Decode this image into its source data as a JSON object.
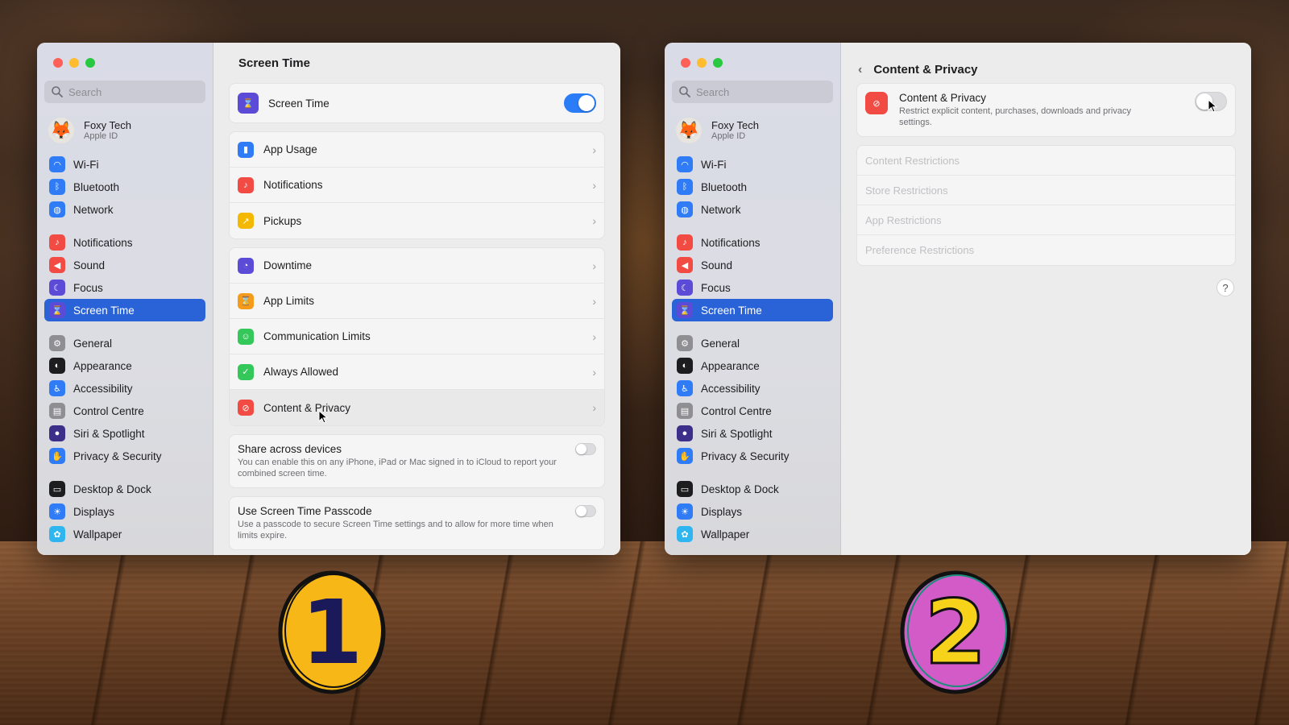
{
  "left_window": {
    "title": "Screen Time",
    "search_placeholder": "Search",
    "profile": {
      "name": "Foxy Tech",
      "sub": "Apple ID"
    },
    "sidebar": [
      {
        "label": "Wi-Fi",
        "icon": "wifi-icon",
        "color": "#2f7cf6"
      },
      {
        "label": "Bluetooth",
        "icon": "bluetooth-icon",
        "color": "#2f7cf6"
      },
      {
        "label": "Network",
        "icon": "globe-icon",
        "color": "#2f7cf6"
      },
      {
        "label": "Notifications",
        "icon": "bell-icon",
        "color": "#f24b44"
      },
      {
        "label": "Sound",
        "icon": "speaker-icon",
        "color": "#f24b44"
      },
      {
        "label": "Focus",
        "icon": "moon-icon",
        "color": "#5b4bd6"
      },
      {
        "label": "Screen Time",
        "icon": "hourglass-icon",
        "color": "#5b4bd6"
      },
      {
        "label": "General",
        "icon": "gear-icon",
        "color": "#8e8e93"
      },
      {
        "label": "Appearance",
        "icon": "appearance-icon",
        "color": "#1d1d1f"
      },
      {
        "label": "Accessibility",
        "icon": "accessibility-icon",
        "color": "#2f7cf6"
      },
      {
        "label": "Control Centre",
        "icon": "control-centre-icon",
        "color": "#8e8e93"
      },
      {
        "label": "Siri & Spotlight",
        "icon": "siri-icon",
        "color": "#3b2f8a"
      },
      {
        "label": "Privacy & Security",
        "icon": "hand-icon",
        "color": "#2f7cf6"
      },
      {
        "label": "Desktop & Dock",
        "icon": "dock-icon",
        "color": "#1d1d1f"
      },
      {
        "label": "Displays",
        "icon": "sun-icon",
        "color": "#2f7cf6"
      },
      {
        "label": "Wallpaper",
        "icon": "wallpaper-icon",
        "color": "#2fb6f0"
      }
    ],
    "screen_time_row": {
      "label": "Screen Time",
      "icon": "hourglass-icon",
      "color": "#5b4bd6"
    },
    "group1": [
      {
        "label": "App Usage",
        "icon": "bar-chart-icon",
        "color": "#2f7cf6"
      },
      {
        "label": "Notifications",
        "icon": "bell-icon",
        "color": "#f24b44"
      },
      {
        "label": "Pickups",
        "icon": "pickups-icon",
        "color": "#f5b800"
      }
    ],
    "group2": [
      {
        "label": "Downtime",
        "icon": "downtime-icon",
        "color": "#5b4bd6"
      },
      {
        "label": "App Limits",
        "icon": "hourglass-icon",
        "color": "#f59b1a"
      },
      {
        "label": "Communication Limits",
        "icon": "person-icon",
        "color": "#34c759"
      },
      {
        "label": "Always Allowed",
        "icon": "checkmark-icon",
        "color": "#34c759"
      },
      {
        "label": "Content & Privacy",
        "icon": "no-entry-icon",
        "color": "#f24b44"
      }
    ],
    "share": {
      "title": "Share across devices",
      "desc": "You can enable this on any iPhone, iPad or Mac signed in to iCloud to report your combined screen time."
    },
    "passcode": {
      "title": "Use Screen Time Passcode",
      "desc": "Use a passcode to secure Screen Time settings and to allow for more time when limits expire."
    }
  },
  "right_window": {
    "title": "Content & Privacy",
    "header_row": {
      "title": "Content & Privacy",
      "desc": "Restrict explicit content, purchases, downloads and privacy settings."
    },
    "restrictions": [
      "Content Restrictions",
      "Store Restrictions",
      "App Restrictions",
      "Preference Restrictions"
    ],
    "help": "?"
  },
  "badges": {
    "one": "1",
    "two": "2",
    "one_color": "#f7b716",
    "two_color": "#d25bc8"
  }
}
